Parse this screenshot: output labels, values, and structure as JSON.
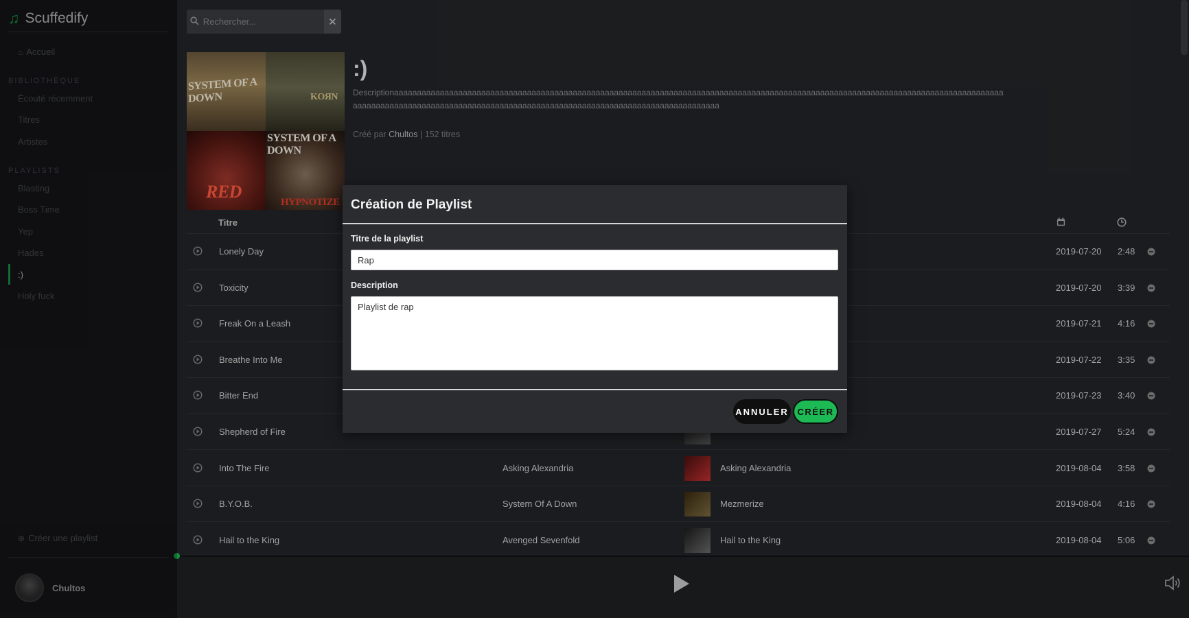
{
  "app": {
    "name": "Scuffedify",
    "logo_icon": "music-note-icon",
    "accent_color": "#1db954"
  },
  "sidebar": {
    "home": {
      "label": "Accueil",
      "icon": "home-icon"
    },
    "library_heading": "BIBLIOTHÈQUE",
    "library_items": [
      {
        "label": "Écouté récemment"
      },
      {
        "label": "Titres"
      },
      {
        "label": "Artistes"
      }
    ],
    "playlists_heading": "PLAYLISTS",
    "playlists": [
      {
        "label": "Blasting"
      },
      {
        "label": "Boss Time"
      },
      {
        "label": "Yep"
      },
      {
        "label": "Hades"
      },
      {
        "label": ":)",
        "active": true
      },
      {
        "label": "Holy fuck"
      }
    ],
    "create_playlist": {
      "label": "Créer une playlist",
      "icon": "plus-circle-icon"
    },
    "user": {
      "name": "Chultos"
    }
  },
  "search": {
    "placeholder": "Rechercher...",
    "value": ""
  },
  "playlist": {
    "covers": [
      {
        "text": "SYSTEM OF A DOWN"
      },
      {
        "text": "KoЯn"
      },
      {
        "text": "RED"
      },
      {
        "text_top": "SYSTEM OF A DOWN",
        "text_bottom": "HYPNOTIZE"
      }
    ],
    "title": ":)",
    "description": "Descriptionaaaaaaaaaaaaaaaaaaaaaaaaaaaaaaaaaaaaaaaaaaaaaaaaaaaaaaaaaaaaaaaaaaaaaaaaaaaaaaaaaaaaaaaaaaaaaaaaaaaaaaaaaaaaaaaaaaaaaaaaaaaaaaaaaaaaaaaaaaaaaaaaaaaaaaaaaaaaaaaaaaaaaaaaaaaaaaaaaaaaaaaaaaaaaaaaaaaaaaaaaaaaaaaaaaaaa",
    "created_prefix": "Créé par",
    "owner": "Chultos",
    "track_count": "| 152 titres"
  },
  "table": {
    "col_title": "Titre",
    "col_date_icon": "calendar-icon",
    "col_duration_icon": "clock-icon",
    "rows": [
      {
        "title": "Lonely Day",
        "artist": "",
        "album": "",
        "date": "2019-07-20",
        "duration": "2:48"
      },
      {
        "title": "Toxicity",
        "artist": "",
        "album": "",
        "date": "2019-07-20",
        "duration": "3:39"
      },
      {
        "title": "Freak On a Leash",
        "artist": "",
        "album": "",
        "date": "2019-07-21",
        "duration": "4:16"
      },
      {
        "title": "Breathe Into Me",
        "artist": "",
        "album": "",
        "date": "2019-07-22",
        "duration": "3:35"
      },
      {
        "title": "Bitter End",
        "artist": "",
        "album": "",
        "date": "2019-07-23",
        "duration": "3:40"
      },
      {
        "title": "Shepherd of Fire",
        "artist": "",
        "album": "",
        "date": "2019-07-27",
        "duration": "5:24"
      },
      {
        "title": "Into The Fire",
        "artist": "Asking Alexandria",
        "album": "Asking Alexandria",
        "date": "2019-08-04",
        "duration": "3:58"
      },
      {
        "title": "B.Y.O.B.",
        "artist": "System Of A Down",
        "album": "Mezmerize",
        "date": "2019-08-04",
        "duration": "4:16"
      },
      {
        "title": "Hail to the King",
        "artist": "Avenged Sevenfold",
        "album": "Hail to the King",
        "date": "2019-08-04",
        "duration": "5:06"
      }
    ]
  },
  "modal": {
    "title": "Création de Playlist",
    "title_label": "Titre de la playlist",
    "title_value": "Rap",
    "description_label": "Description",
    "description_value": "Playlist de rap",
    "cancel_label": "ANNULER",
    "create_label": "CRÉER"
  },
  "player": {
    "play_icon": "play-icon",
    "volume_icon": "volume-icon"
  }
}
